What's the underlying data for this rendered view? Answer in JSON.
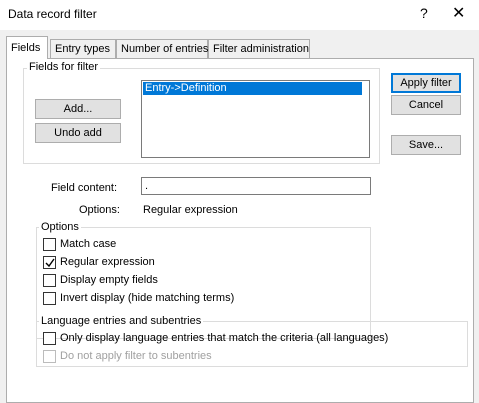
{
  "window": {
    "title": "Data record filter",
    "help_glyph": "?",
    "close_glyph": "✕"
  },
  "tabs": [
    {
      "label": "Fields"
    },
    {
      "label": "Entry types"
    },
    {
      "label": "Number of entries"
    },
    {
      "label": "Filter administration"
    }
  ],
  "fields_group": {
    "label": "Fields for filter",
    "add_label": "Add...",
    "undo_add_label": "Undo add",
    "list_items": [
      "Entry->Definition"
    ]
  },
  "side_buttons": {
    "apply": "Apply filter",
    "cancel": "Cancel",
    "save": "Save..."
  },
  "field_content": {
    "label": "Field content:",
    "value": "."
  },
  "options_line": {
    "label": "Options:",
    "value": "Regular expression"
  },
  "options_group": {
    "label": "Options",
    "items": [
      {
        "label": "Match case",
        "checked": false
      },
      {
        "label": "Regular expression",
        "checked": true
      },
      {
        "label": "Display empty fields",
        "checked": false
      },
      {
        "label": "Invert display (hide matching terms)",
        "checked": false
      }
    ]
  },
  "language_group": {
    "label": "Language entries and subentries",
    "items": [
      {
        "label": "Only display language entries that match the criteria (all languages)",
        "checked": false,
        "enabled": true
      },
      {
        "label": "Do not apply filter to subentries",
        "checked": false,
        "enabled": false
      }
    ]
  }
}
